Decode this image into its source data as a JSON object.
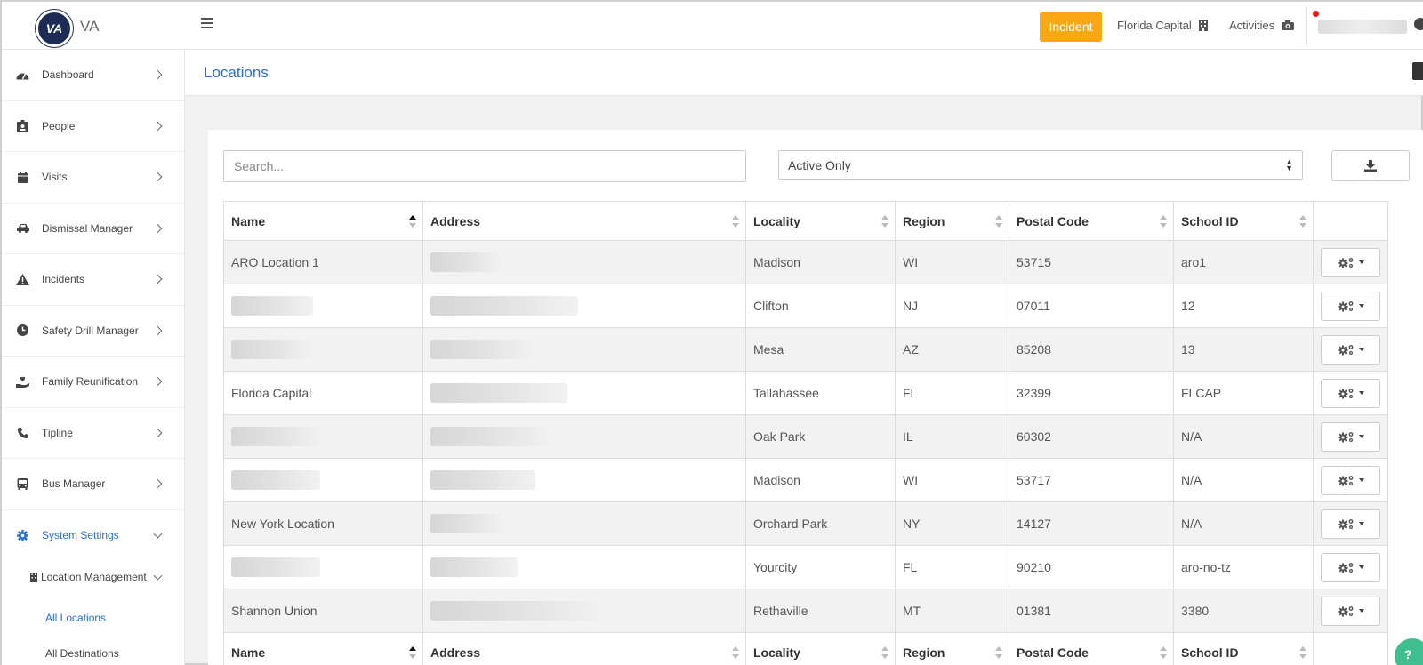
{
  "brand": {
    "logo_text": "VA",
    "name": "VA"
  },
  "topbar": {
    "incident_label": "Incident",
    "location_label": "Florida Capital",
    "activities_label": "Activities"
  },
  "sidebar": {
    "items": [
      {
        "label": "Dashboard",
        "icon": "gauge-icon"
      },
      {
        "label": "People",
        "icon": "id-badge-icon"
      },
      {
        "label": "Visits",
        "icon": "calendar-icon"
      },
      {
        "label": "Dismissal Manager",
        "icon": "car-icon"
      },
      {
        "label": "Incidents",
        "icon": "warning-icon"
      },
      {
        "label": "Safety Drill Manager",
        "icon": "clock-icon"
      },
      {
        "label": "Family Reunification",
        "icon": "hand-heart-icon"
      },
      {
        "label": "Tipline",
        "icon": "phone-icon"
      },
      {
        "label": "Bus Manager",
        "icon": "bus-icon"
      }
    ],
    "settings_label": "System Settings",
    "location_management_label": "Location Management",
    "all_locations_label": "All Locations",
    "all_destinations_label": "All Destinations"
  },
  "page": {
    "title": "Locations"
  },
  "filters": {
    "search_placeholder": "Search...",
    "status_selected": "Active Only"
  },
  "table": {
    "columns": [
      "Name",
      "Address",
      "Locality",
      "Region",
      "Postal Code",
      "School ID"
    ],
    "rows": [
      {
        "name": "ARO Location 1",
        "locality": "Madison",
        "region": "WI",
        "postal": "53715",
        "school_id": "aro1"
      },
      {
        "name": "",
        "locality": "Clifton",
        "region": "NJ",
        "postal": "07011",
        "school_id": "12"
      },
      {
        "name": "",
        "locality": "Mesa",
        "region": "AZ",
        "postal": "85208",
        "school_id": "13"
      },
      {
        "name": "Florida Capital",
        "locality": "Tallahassee",
        "region": "FL",
        "postal": "32399",
        "school_id": "FLCAP"
      },
      {
        "name": "",
        "locality": "Oak Park",
        "region": "IL",
        "postal": "60302",
        "school_id": "N/A"
      },
      {
        "name": "",
        "locality": "Madison",
        "region": "WI",
        "postal": "53717",
        "school_id": "N/A"
      },
      {
        "name": "New York Location",
        "locality": "Orchard Park",
        "region": "NY",
        "postal": "14127",
        "school_id": "N/A"
      },
      {
        "name": "",
        "locality": "Yourcity",
        "region": "FL",
        "postal": "90210",
        "school_id": "aro-no-tz"
      },
      {
        "name": "Shannon Union",
        "locality": "Rethaville",
        "region": "MT",
        "postal": "01381",
        "school_id": "3380"
      }
    ]
  },
  "help": {
    "label": "?"
  },
  "colors": {
    "accent": "#2a6ed3",
    "incident": "#f7a814",
    "logo": "#1d2c55",
    "help": "#3fbf8f"
  }
}
